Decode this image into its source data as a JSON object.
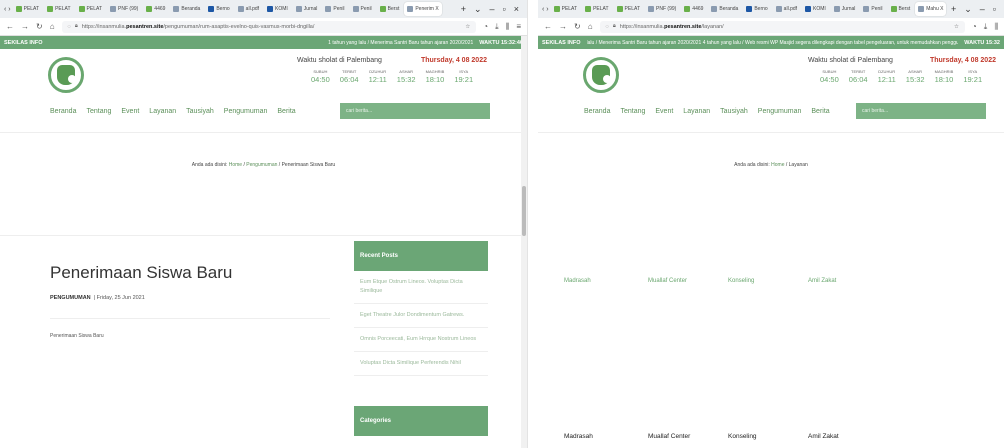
{
  "left": {
    "tabs": [
      {
        "label": "PELAT",
        "kind": "g"
      },
      {
        "label": "PELAT",
        "kind": "g"
      },
      {
        "label": "PELAT",
        "kind": "g"
      },
      {
        "label": "PNF (99)",
        "kind": ""
      },
      {
        "label": "4469",
        "kind": "g"
      },
      {
        "label": "Beranda",
        "kind": ""
      },
      {
        "label": "Berno",
        "kind": "b"
      },
      {
        "label": "all.pdf",
        "kind": ""
      },
      {
        "label": "KOMI",
        "kind": "b"
      },
      {
        "label": "Jurnal",
        "kind": ""
      },
      {
        "label": "Penil",
        "kind": ""
      },
      {
        "label": "Penil",
        "kind": ""
      },
      {
        "label": "Berst",
        "kind": "g"
      },
      {
        "label": "Penerim X",
        "kind": "active"
      }
    ],
    "url_prefix": "https://insanmulia.",
    "url_domain": "pesantren.site",
    "url_path": "/pengumuman/rum-asaptis-evelno-quis-vasmus-morbi-dngilla/",
    "ticker_label": "SEKILAS INFO",
    "ticker_message": "1 tahun yang lalu / Menerima Santri Baru tahun ajaran 2020/2021",
    "ticker_clock": "WAKTU 15:32:46",
    "prayer_title": "Waktu sholat di Palembang",
    "prayer_date": "Thursday, 4 08 2022",
    "prayer_times": [
      {
        "name": "SUBUH",
        "time": "04:50"
      },
      {
        "name": "TERBIT",
        "time": "06:04"
      },
      {
        "name": "DZUHUR",
        "time": "12:11"
      },
      {
        "name": "ASHAR",
        "time": "15:32"
      },
      {
        "name": "MAGHRIB",
        "time": "18:10"
      },
      {
        "name": "ISYA",
        "time": "19:21"
      }
    ],
    "nav": [
      "Beranda",
      "Tentang",
      "Event",
      "Layanan",
      "Tausiyah",
      "Pengumuman",
      "Berita"
    ],
    "search_placeholder": "cari berita...",
    "crumb_prefix": "Anda ada disini:",
    "crumb_home": "Home",
    "crumb_section": "Pengumuman",
    "crumb_current": "/ Penerimaan Siswa Baru",
    "post_title": "Penerimaan Siswa Baru",
    "post_category": "PENGUMUMAN",
    "post_date": "| Friday, 25 Jun 2021",
    "post_body": "Penerimaan Siswa Baru",
    "recent_posts_title": "Recent Posts",
    "recent_posts": [
      "Eum Etque Ostrum Lineos. Voluptas Dicta Similique",
      "Eget Theatre Julor Dondimentum Gatrews.",
      "Omnis Porceecati, Eum Hrrque Nostrum Lineos",
      "Voluptas Dicta Similique Perferendis Nihil"
    ],
    "categories_title": "Categories"
  },
  "right": {
    "tabs": [
      {
        "label": "PELAT",
        "kind": "g"
      },
      {
        "label": "PELAT",
        "kind": "g"
      },
      {
        "label": "PELAT",
        "kind": "g"
      },
      {
        "label": "PNF (99)",
        "kind": ""
      },
      {
        "label": "4469",
        "kind": "g"
      },
      {
        "label": "Beranda",
        "kind": ""
      },
      {
        "label": "Berno",
        "kind": "b"
      },
      {
        "label": "all.pdf",
        "kind": ""
      },
      {
        "label": "KOMI",
        "kind": "b"
      },
      {
        "label": "Jurnal",
        "kind": ""
      },
      {
        "label": "Penil",
        "kind": ""
      },
      {
        "label": "Berst",
        "kind": "g"
      },
      {
        "label": "Mahu X",
        "kind": "active"
      }
    ],
    "url_prefix": "https://insanmulia.",
    "url_domain": "pesantren.site",
    "url_path": "/layanan/",
    "ticker_label": "SEKILAS INFO",
    "ticker_message": "lalu / Menerima Santri Baru tahun ajaran 2020/2021     4 tahun yang lalu / Web resmi WP Masjid segera dilengkapi dengan tabel pengeluaran, untuk memudahkan pengguna mempelajari",
    "ticker_clock": "WAKTU 15:32",
    "prayer_title": "Waktu sholat di Palembang",
    "prayer_date": "Thursday, 4 08 2022",
    "prayer_times": [
      {
        "name": "SUBUH",
        "time": "04:50"
      },
      {
        "name": "TERBIT",
        "time": "06:04"
      },
      {
        "name": "DZUHUR",
        "time": "12:11"
      },
      {
        "name": "ASHAR",
        "time": "15:32"
      },
      {
        "name": "MAGHRIB",
        "time": "18:10"
      },
      {
        "name": "ISYA",
        "time": "19:21"
      }
    ],
    "nav": [
      "Beranda",
      "Tentang",
      "Event",
      "Layanan",
      "Tausiyah",
      "Pengumuman",
      "Berita"
    ],
    "search_placeholder": "cari berita...",
    "crumb_prefix": "Anda ada disini:",
    "crumb_home": "Home",
    "crumb_current": "/ Layanan",
    "services_top": [
      "Madrasah",
      "Muallaf Center",
      "Konseling",
      "Amil Zakat"
    ],
    "services_bottom": [
      "Madrasah",
      "Muallaf Center",
      "Konseling",
      "Amil Zakat"
    ]
  },
  "colors": {
    "accent": "#6ba676",
    "date": "#c0392b"
  }
}
